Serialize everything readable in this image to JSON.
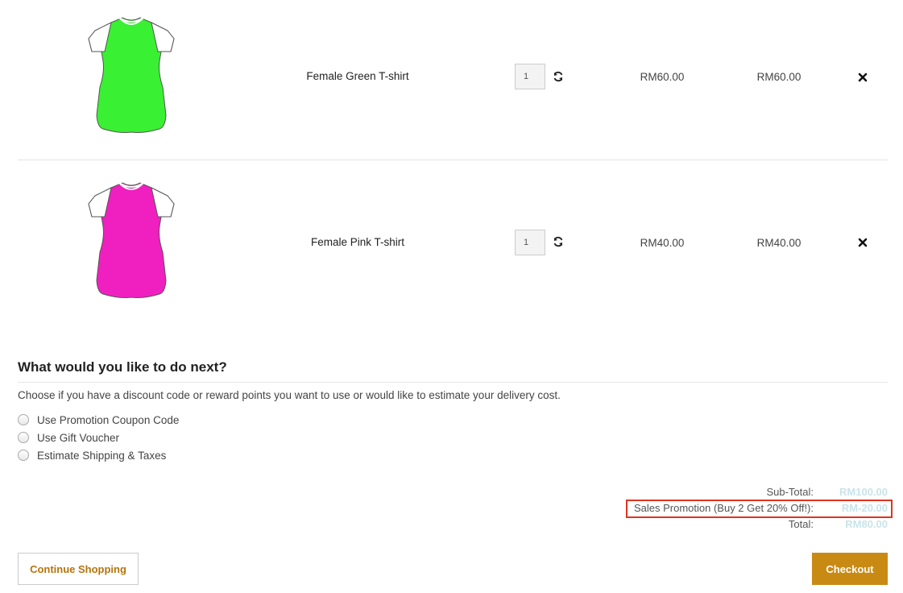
{
  "cart": {
    "items": [
      {
        "name": "Female Green T-shirt",
        "quantity": "1",
        "unit_price": "RM60.00",
        "total": "RM60.00",
        "color": "#39f032",
        "collar_color": "#22c91e"
      },
      {
        "name": "Female Pink T-shirt",
        "quantity": "1",
        "unit_price": "RM40.00",
        "total": "RM40.00",
        "color": "#f01fc0",
        "collar_color": "#a51e8c"
      }
    ]
  },
  "next": {
    "title": "What would you like to do next?",
    "description": "Choose if you have a discount code or reward points you want to use or would like to estimate your delivery cost.",
    "options": [
      "Use Promotion Coupon Code",
      "Use Gift Voucher",
      "Estimate Shipping & Taxes"
    ]
  },
  "totals": {
    "subtotal_label": "Sub-Total:",
    "subtotal_value": "RM100.00",
    "promo_label": "Sales Promotion (Buy 2 Get 20% Off!):",
    "promo_value": "RM-20.00",
    "total_label": "Total:",
    "total_value": "RM80.00"
  },
  "actions": {
    "continue_label": "Continue Shopping",
    "checkout_label": "Checkout"
  },
  "colors": {
    "accent": "#c98a14",
    "highlight_box": "#e0341f",
    "total_values": "#c8e4ea"
  },
  "icons": {
    "refresh": "refresh-icon",
    "remove": "remove-icon",
    "radio": "radio-icon"
  }
}
